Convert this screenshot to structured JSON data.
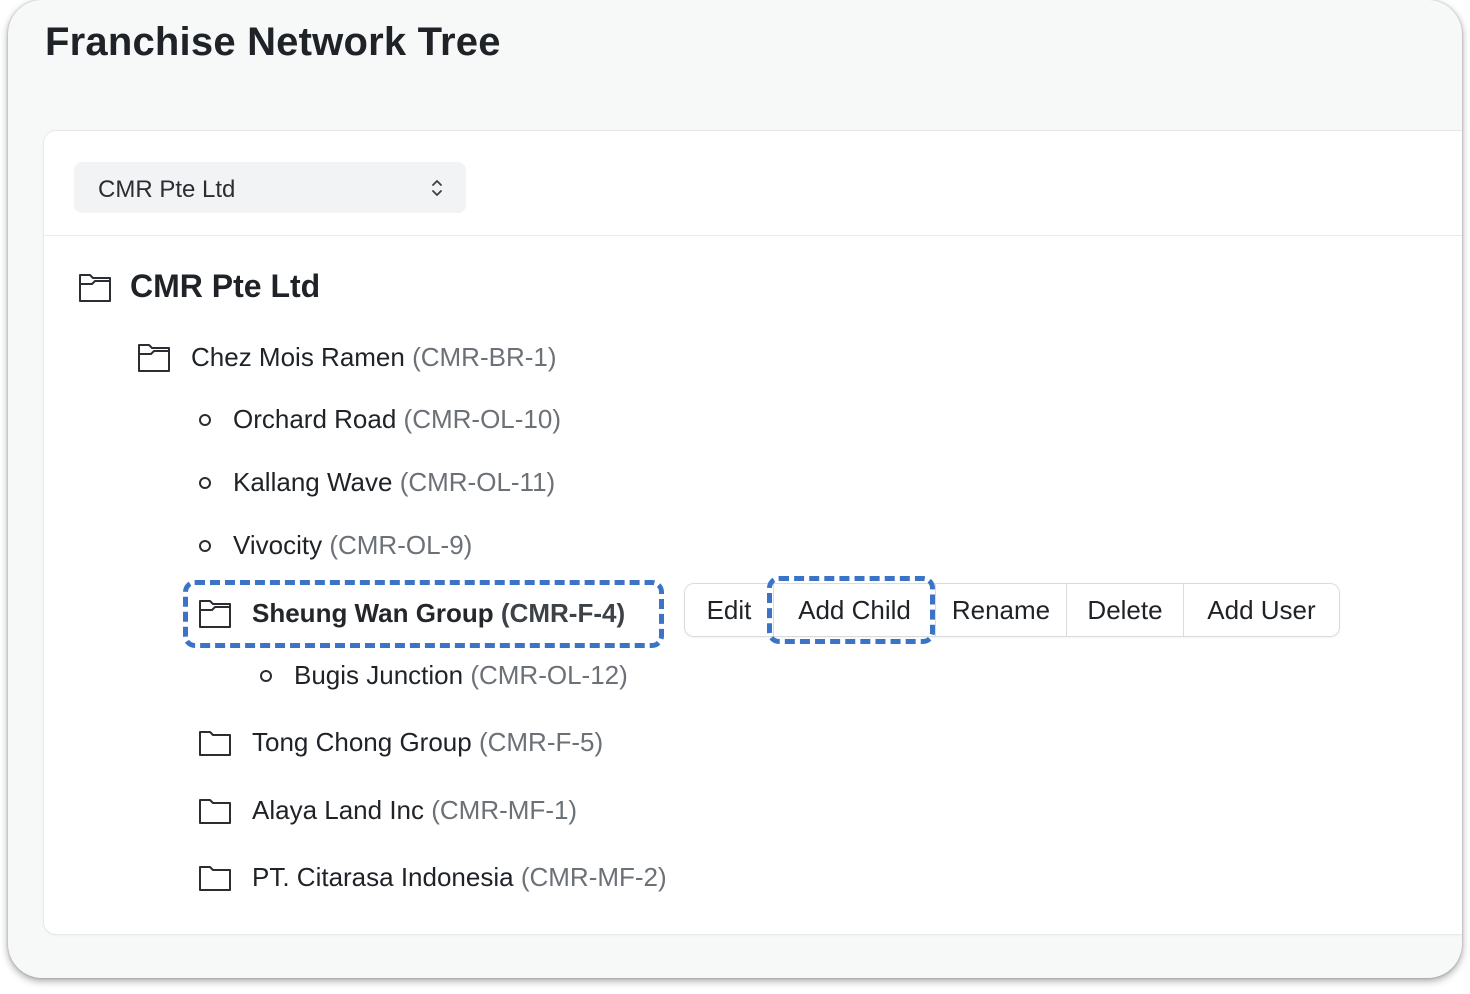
{
  "page": {
    "title": "Franchise Network Tree"
  },
  "selector": {
    "value": "CMR Pte Ltd"
  },
  "tree": {
    "root": {
      "name": "CMR Pte Ltd",
      "icon": "folder-icon"
    },
    "nodes": [
      {
        "name": "Chez Mois Ramen",
        "code": "(CMR-BR-1)",
        "icon": "folder-open-icon"
      },
      {
        "name": "Orchard Road",
        "code": "(CMR-OL-10)",
        "icon": "circle-bullet-icon"
      },
      {
        "name": "Kallang Wave",
        "code": "(CMR-OL-11)",
        "icon": "circle-bullet-icon"
      },
      {
        "name": "Vivocity",
        "code": "(CMR-OL-9)",
        "icon": "circle-bullet-icon"
      },
      {
        "name": "Sheung Wan Group",
        "code": "(CMR-F-4)",
        "icon": "folder-open-icon",
        "selected": true
      },
      {
        "name": "Bugis Junction",
        "code": "(CMR-OL-12)",
        "icon": "circle-bullet-icon"
      },
      {
        "name": "Tong Chong Group",
        "code": "(CMR-F-5)",
        "icon": "folder-icon"
      },
      {
        "name": "Alaya Land Inc",
        "code": "(CMR-MF-1)",
        "icon": "folder-icon"
      },
      {
        "name": "PT. Citarasa Indonesia",
        "code": "(CMR-MF-2)",
        "icon": "folder-icon"
      }
    ]
  },
  "actions": {
    "edit": "Edit",
    "add_child": "Add Child",
    "rename": "Rename",
    "delete": "Delete",
    "add_user": "Add User"
  },
  "colors": {
    "highlight_dash": "#3b73c7",
    "code_text": "#6b7177"
  }
}
